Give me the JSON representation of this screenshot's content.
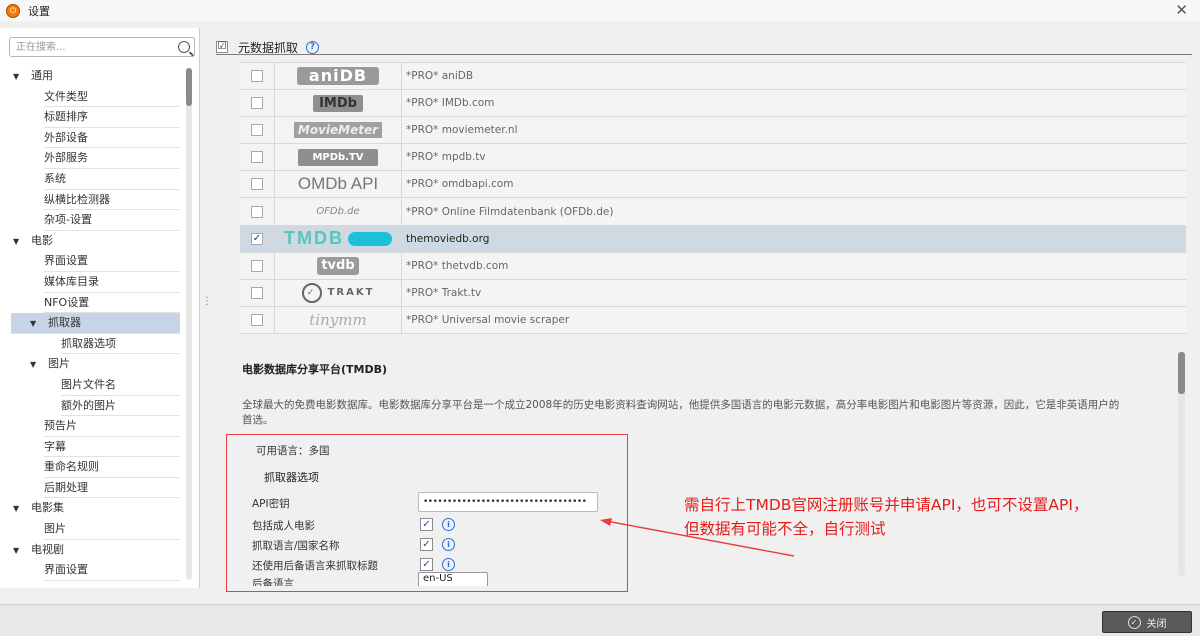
{
  "window": {
    "title": "设置"
  },
  "search": {
    "placeholder": "正在搜索..."
  },
  "sidebar": {
    "items": [
      {
        "label": "通用",
        "caret": "▼"
      },
      {
        "label": "文件类型"
      },
      {
        "label": "标题排序"
      },
      {
        "label": "外部设备"
      },
      {
        "label": "外部服务"
      },
      {
        "label": "系统"
      },
      {
        "label": "纵横比检测器"
      },
      {
        "label": "杂项-设置"
      },
      {
        "label": "电影",
        "caret": "▼"
      },
      {
        "label": "界面设置"
      },
      {
        "label": "媒体库目录"
      },
      {
        "label": "NFO设置"
      },
      {
        "label": "抓取器",
        "caret": "▼"
      },
      {
        "label": "抓取器选项"
      },
      {
        "label": "图片",
        "caret": "▼"
      },
      {
        "label": "图片文件名"
      },
      {
        "label": "额外的图片"
      },
      {
        "label": "预告片"
      },
      {
        "label": "字幕"
      },
      {
        "label": "重命名规则"
      },
      {
        "label": "后期处理"
      },
      {
        "label": "电影集",
        "caret": "▼"
      },
      {
        "label": "图片"
      },
      {
        "label": "电视剧",
        "caret": "▼"
      },
      {
        "label": "界面设置"
      }
    ]
  },
  "section": {
    "title": "元数据抓取",
    "checkbox": "☑",
    "help": "?"
  },
  "scrapers": [
    {
      "logo": "aniDB",
      "name": "*PRO* aniDB"
    },
    {
      "logo": "IMDb",
      "name": "*PRO* IMDb.com"
    },
    {
      "logo": "MovieMeter",
      "name": "*PRO* moviemeter.nl"
    },
    {
      "logo": "MPDb.TV",
      "name": "*PRO* mpdb.tv"
    },
    {
      "logo": "OMDb API",
      "name": "*PRO* omdbapi.com"
    },
    {
      "logo": "OFDb.de",
      "name": "*PRO* Online Filmdatenbank (OFDb.de)"
    },
    {
      "logo": "TMDB",
      "name": "themoviedb.org",
      "checked": "✓"
    },
    {
      "logo": "tvdb",
      "name": "*PRO* thetvdb.com"
    },
    {
      "logo": "TRAKT",
      "name": "*PRO* Trakt.tv"
    },
    {
      "logo": "tinymm",
      "name": "*PRO* Universal movie scraper"
    }
  ],
  "details": {
    "title": "电影数据库分享平台(TMDB)",
    "description": "全球最大的免费电影数据库。电影数据库分享平台是一个成立2008年的历史电影资料查询网站，他提供多国语言的电影元数据，高分率电影图片和电影图片等资源，因此，它是非英语用户的首选。",
    "languages": "可用语言：多国",
    "options_heading": "抓取器选项",
    "api_label": "API密钥",
    "api_value": "••••••••••••••••••••••••••••••••••",
    "adult_label": "包括成人电影",
    "country_label": "抓取语言/国家名称",
    "fallback_label": "还使用后备语言来抓取标题",
    "fallback_lang_label": "后备语言",
    "fallback_lang_value": "en-US"
  },
  "annotation": {
    "line1": "需自行上TMDB官网注册账号并申请API，也可不设置API，",
    "line2": "但数据有可能不全，自行测试"
  },
  "footer": {
    "close_label": "关闭"
  },
  "colors": {
    "selection": "#c6d4e6",
    "annotation": "#e51c1c",
    "accent": "#2a6fdb"
  }
}
